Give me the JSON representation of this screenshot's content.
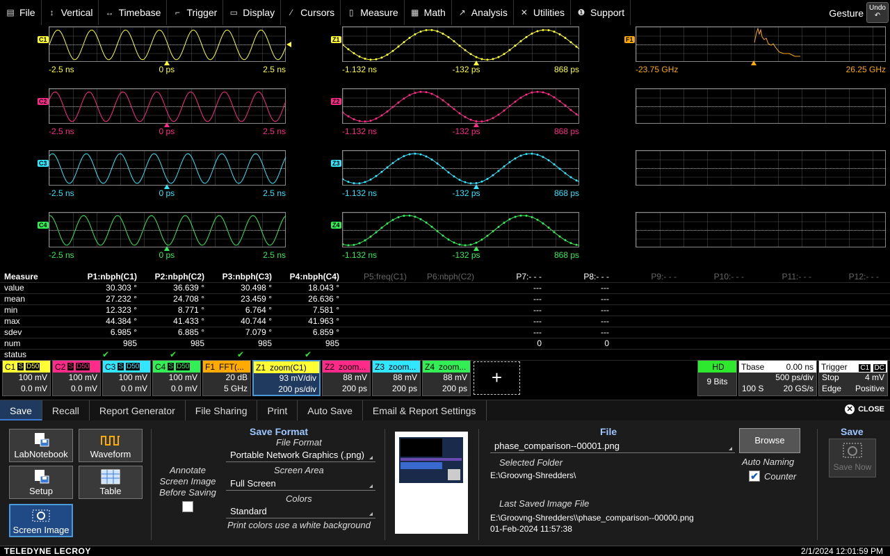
{
  "menubar": {
    "items": [
      {
        "label": "File",
        "icon": "file-icon",
        "glyph": "▤"
      },
      {
        "label": "Vertical",
        "icon": "vertical-arrows-icon",
        "glyph": "↕"
      },
      {
        "label": "Timebase",
        "icon": "horizontal-arrows-icon",
        "glyph": "↔"
      },
      {
        "label": "Trigger",
        "icon": "trigger-icon",
        "glyph": "⌐"
      },
      {
        "label": "Display",
        "icon": "display-icon",
        "glyph": "▭"
      },
      {
        "label": "Cursors",
        "icon": "cursors-icon",
        "glyph": "⁄"
      },
      {
        "label": "Measure",
        "icon": "measure-icon",
        "glyph": "▯"
      },
      {
        "label": "Math",
        "icon": "math-icon",
        "glyph": "▦"
      },
      {
        "label": "Analysis",
        "icon": "analysis-icon",
        "glyph": "↗"
      },
      {
        "label": "Utilities",
        "icon": "utilities-icon",
        "glyph": "✕"
      },
      {
        "label": "Support",
        "icon": "support-icon",
        "glyph": "❶"
      }
    ],
    "gesture_label": "Gesture",
    "undo_label": "Undo"
  },
  "grids": {
    "channels": [
      {
        "tag": "C1",
        "color": "#ffff33",
        "left": "-2.5 ns",
        "mid": "0 ps",
        "right": "2.5 ns"
      },
      {
        "tag": "C2",
        "color": "#ff2a8a",
        "left": "-2.5 ns",
        "mid": "0 ps",
        "right": "2.5 ns"
      },
      {
        "tag": "C3",
        "color": "#33e6ff",
        "left": "-2.5 ns",
        "mid": "0 ps",
        "right": "2.5 ns"
      },
      {
        "tag": "C4",
        "color": "#33ee55",
        "left": "-2.5 ns",
        "mid": "0 ps",
        "right": "2.5 ns"
      }
    ],
    "zooms": [
      {
        "tag": "Z1",
        "color": "#ffff33",
        "left": "-1.132 ns",
        "mid": "-132 ps",
        "right": "868 ps"
      },
      {
        "tag": "Z2",
        "color": "#ff2a8a",
        "left": "-1.132 ns",
        "mid": "-132 ps",
        "right": "868 ps"
      },
      {
        "tag": "Z3",
        "color": "#33e6ff",
        "left": "-1.132 ns",
        "mid": "-132 ps",
        "right": "868 ps"
      },
      {
        "tag": "Z4",
        "color": "#33ee55",
        "left": "-1.132 ns",
        "mid": "-132 ps",
        "right": "868 ps"
      }
    ],
    "fft": {
      "tag": "F1",
      "color": "#ffaa00",
      "left": "-23.75 GHz",
      "right": "26.25 GHz"
    }
  },
  "measure": {
    "title": "Measure",
    "headers": [
      "P1:nbph(C1)",
      "P2:nbph(C2)",
      "P3:nbph(C3)",
      "P4:nbph(C4)",
      "P5:freq(C1)",
      "P6:nbph(C2)",
      "P7:- - -",
      "P8:- - -",
      "P9:- - -",
      "P10:- - -",
      "P11:- - -",
      "P12:- - -"
    ],
    "rows": [
      {
        "label": "value",
        "vals": [
          "30.303 °",
          "36.639 °",
          "30.498 °",
          "18.043 °",
          "",
          "",
          "---",
          "---"
        ]
      },
      {
        "label": "mean",
        "vals": [
          "27.232 °",
          "24.708 °",
          "23.459 °",
          "26.636 °",
          "",
          "",
          "---",
          "---"
        ]
      },
      {
        "label": "min",
        "vals": [
          "12.323 °",
          "8.771 °",
          "6.764 °",
          "7.581 °",
          "",
          "",
          "---",
          "---"
        ]
      },
      {
        "label": "max",
        "vals": [
          "44.384 °",
          "41.433 °",
          "40.744 °",
          "41.963 °",
          "",
          "",
          "---",
          "---"
        ]
      },
      {
        "label": "sdev",
        "vals": [
          "6.985 °",
          "6.885 °",
          "7.079 °",
          "6.859 °",
          "",
          "",
          "---",
          "---"
        ]
      },
      {
        "label": "num",
        "vals": [
          "985",
          "985",
          "985",
          "985",
          "",
          "",
          "0",
          "0"
        ]
      },
      {
        "label": "status",
        "vals": [
          "✔",
          "✔",
          "✔",
          "✔",
          "",
          "",
          "",
          ""
        ]
      }
    ]
  },
  "chanbar": {
    "channels": [
      {
        "name": "C1",
        "badges": [
          "S",
          "D50"
        ],
        "v1": "100 mV",
        "v2": "0.0 mV",
        "color": "#ffff33"
      },
      {
        "name": "C2",
        "badges": [
          "S",
          "D50"
        ],
        "v1": "100 mV",
        "v2": "0.0 mV",
        "color": "#ff2a8a"
      },
      {
        "name": "C3",
        "badges": [
          "S",
          "D50"
        ],
        "v1": "100 mV",
        "v2": "0.0 mV",
        "color": "#33e6ff"
      },
      {
        "name": "C4",
        "badges": [
          "S",
          "D50"
        ],
        "v1": "100 mV",
        "v2": "0.0 mV",
        "color": "#33ee55"
      },
      {
        "name": "F1",
        "title": "FFT(...",
        "v1": "20 dB",
        "v2": "5 GHz",
        "color": "#ffaa00"
      },
      {
        "name": "Z1",
        "title": "zoom(C1)",
        "v1": "93 mV/div",
        "v2": "200 ps/div",
        "color": "#ffff33"
      },
      {
        "name": "Z2",
        "title": "zoom...",
        "v1": "88 mV",
        "v2": "200 ps",
        "color": "#ff2a8a"
      },
      {
        "name": "Z3",
        "title": "zoom...",
        "v1": "88 mV",
        "v2": "200 ps",
        "color": "#33e6ff"
      },
      {
        "name": "Z4",
        "title": "zoom...",
        "v1": "88 mV",
        "v2": "200 ps",
        "color": "#33ee55"
      }
    ],
    "add_label": "+",
    "hd": {
      "title": "HD",
      "value": "9 Bits"
    },
    "tbase": {
      "title": "Tbase",
      "offset": "0.00 ns",
      "div": "500 ps/div",
      "samples": "100 S",
      "rate": "20 GS/s"
    },
    "trigger": {
      "title": "Trigger",
      "src": "C1",
      "coupling": "DC",
      "mode": "Stop",
      "level": "4 mV",
      "type": "Edge",
      "slope": "Positive"
    }
  },
  "tabs": [
    "Save",
    "Recall",
    "Report Generator",
    "File Sharing",
    "Print",
    "Auto Save",
    "Email & Report Settings"
  ],
  "close_label": "CLOSE",
  "save_panel": {
    "buttons": [
      "LabNotebook",
      "Waveform",
      "Setup",
      "Table",
      "Screen Image"
    ],
    "annotate_label": "Annotate Screen Image Before Saving",
    "format_title": "Save Format",
    "file_format_label": "File Format",
    "file_format_value": "Portable Network Graphics (.png)",
    "screen_area_label": "Screen Area",
    "screen_area_value": "Full Screen",
    "colors_label": "Colors",
    "colors_value": "Standard",
    "colors_note": "Print colors use a white background",
    "file_title": "File",
    "file_name": "phase_comparison--00001.png",
    "browse_label": "Browse",
    "selected_folder_label": "Selected Folder",
    "selected_folder": "E:\\Groovng-Shredders\\",
    "auto_naming_label": "Auto Naming",
    "counter_label": "Counter",
    "last_saved_label": "Last Saved Image File",
    "last_saved_path": "E:\\Groovng-Shredders\\\\phase_comparison--00000.png",
    "last_saved_time": "01-Feb-2024 11:57:38",
    "save_title": "Save",
    "save_now_label": "Save Now"
  },
  "footer": {
    "brand": "TELEDYNE LECROY",
    "clock": "2/1/2024 12:01:59 PM"
  }
}
